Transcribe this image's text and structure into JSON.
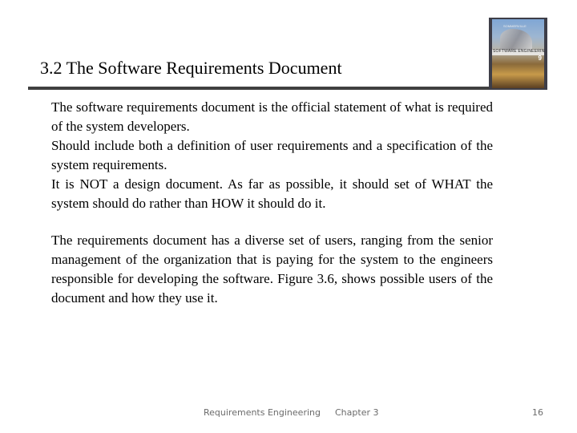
{
  "slide": {
    "title": "3.2 The Software Requirements Document",
    "cover_image": {
      "icon": "book-cover-image",
      "author": "SOMMERVILLE",
      "band_text": "SOFTWARE ENGINEERING",
      "edition": "9"
    },
    "paragraphs": [
      {
        "lines": [
          "The software requirements document is the official statement of what is required of the system developers.",
          "Should include both a definition of user requirements and a specification of the system requirements.",
          "It is NOT a design document. As far as possible, it should set of WHAT the system should do rather than HOW it should do it."
        ]
      },
      {
        "lines": [
          "The requirements document has a diverse set of users, ranging from the senior management of the organization that is paying for the system to the engineers responsible for developing the software. Figure 3.6, shows possible users of the document and how they use it."
        ]
      }
    ],
    "footer": {
      "left": "Requirements Engineering",
      "center": "Chapter 3",
      "page_number": "16"
    }
  }
}
